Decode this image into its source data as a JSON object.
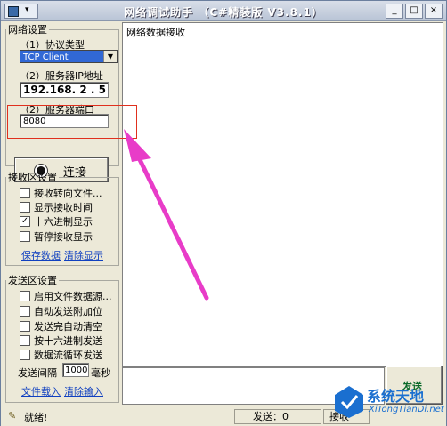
{
  "window": {
    "title": "网络调试助手 （C#精装版 V3.8.1）",
    "controls": [
      "_",
      "□",
      "×"
    ]
  },
  "net_settings": {
    "legend": "网络设置",
    "protocol_label": "（1）协议类型",
    "protocol_value": "TCP Client",
    "server_ip_label": "（2）服务器IP地址",
    "server_ip_value": "192.168. 2 . 5",
    "server_port_label": "（2）服务器端口",
    "server_port_value": "8080",
    "connect_label": "连接"
  },
  "recv_settings": {
    "legend": "接收区设置",
    "options": [
      {
        "label": "接收转向文件...",
        "checked": false
      },
      {
        "label": "显示接收时间",
        "checked": false
      },
      {
        "label": "十六进制显示",
        "checked": true
      },
      {
        "label": "暂停接收显示",
        "checked": false
      }
    ],
    "save_link": "保存数据",
    "clear_link": "清除显示"
  },
  "send_settings": {
    "legend": "发送区设置",
    "options": [
      {
        "label": "启用文件数据源...",
        "checked": false
      },
      {
        "label": "自动发送附加位",
        "checked": false
      },
      {
        "label": "发送完自动清空",
        "checked": false
      },
      {
        "label": "按十六进制发送",
        "checked": false
      },
      {
        "label": "数据流循环发送",
        "checked": false
      }
    ],
    "interval_label": "发送间隔",
    "interval_value": "1000",
    "interval_unit": "毫秒",
    "load_link": "文件载入",
    "clear_input_link": "清除输入"
  },
  "recv_area": {
    "caption": "网络数据接收"
  },
  "send_button": "发送",
  "status_bar": {
    "ready": "就绪!",
    "sent": "发送：0",
    "recv": "接收"
  },
  "watermark": {
    "line1": "系统天地",
    "line2": "XiTongTianDi.net"
  },
  "colors": {
    "annotation": "#e0301e",
    "arrow": "#e83cc8",
    "link": "#1040c0"
  }
}
